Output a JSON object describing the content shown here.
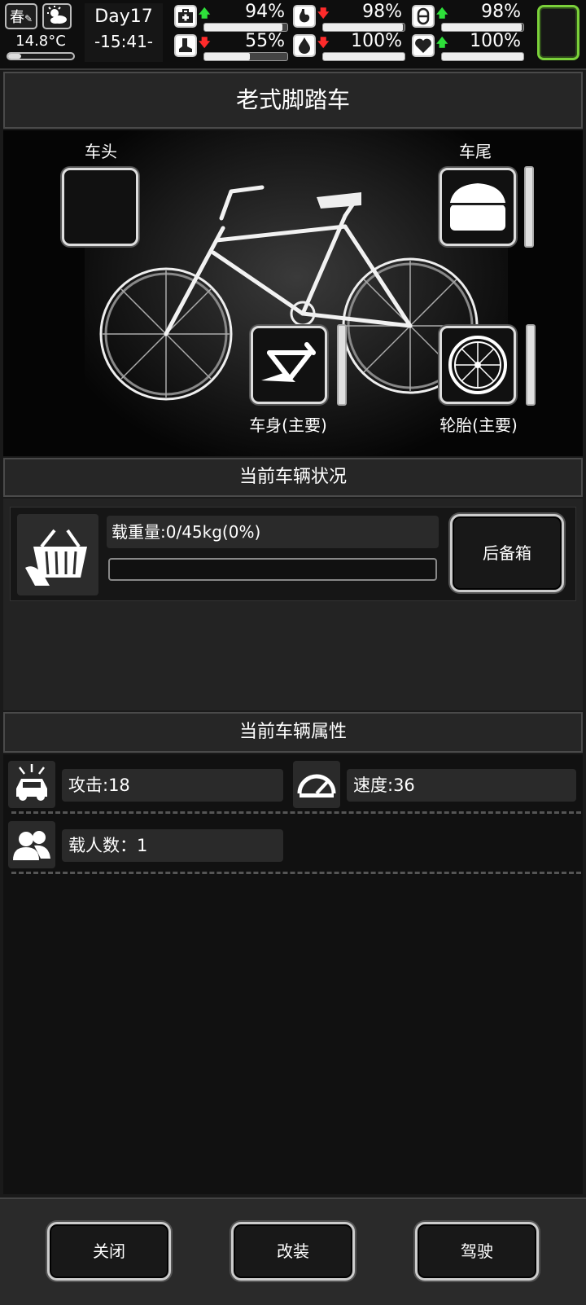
{
  "status": {
    "season": "春",
    "temperature": "14.8°C",
    "day": "Day17",
    "time": "-15:41-",
    "stats": [
      {
        "name": "health",
        "icon": "medkit-icon",
        "trend": "up",
        "value": "94%",
        "level": 0.94
      },
      {
        "name": "hunger",
        "icon": "stomach-icon",
        "trend": "down",
        "value": "98%",
        "level": 0.98
      },
      {
        "name": "medicine",
        "icon": "pill-icon",
        "trend": "up",
        "value": "98%",
        "level": 0.98
      },
      {
        "name": "stamina",
        "icon": "boot-icon",
        "trend": "down",
        "value": "55%",
        "level": 0.55
      },
      {
        "name": "thirst",
        "icon": "water-drop-icon",
        "trend": "down",
        "value": "100%",
        "level": 1.0
      },
      {
        "name": "mood",
        "icon": "heart-icon",
        "trend": "up",
        "value": "100%",
        "level": 1.0
      }
    ],
    "arrows": {
      "up": "🡅",
      "down": "🡇"
    }
  },
  "vehicle": {
    "title": "老式脚踏车",
    "slots": {
      "head": "车头",
      "tail": "车尾",
      "body": "车身(主要)",
      "tire": "轮胎(主要)"
    }
  },
  "condition": {
    "header": "当前车辆状况",
    "load_text": "载重量:0/45kg(0%)",
    "load_level": 0.0,
    "trunk_button": "后备箱"
  },
  "attributes": {
    "header": "当前车辆属性",
    "attack": "攻击:18",
    "speed": "速度:36",
    "passengers": "载人数：1"
  },
  "footer": {
    "close": "关闭",
    "modify": "改装",
    "drive": "驾驶"
  },
  "colors": {
    "up": "#2ee03a",
    "down": "#ff2b2b",
    "accent_green": "#7bd13a"
  }
}
